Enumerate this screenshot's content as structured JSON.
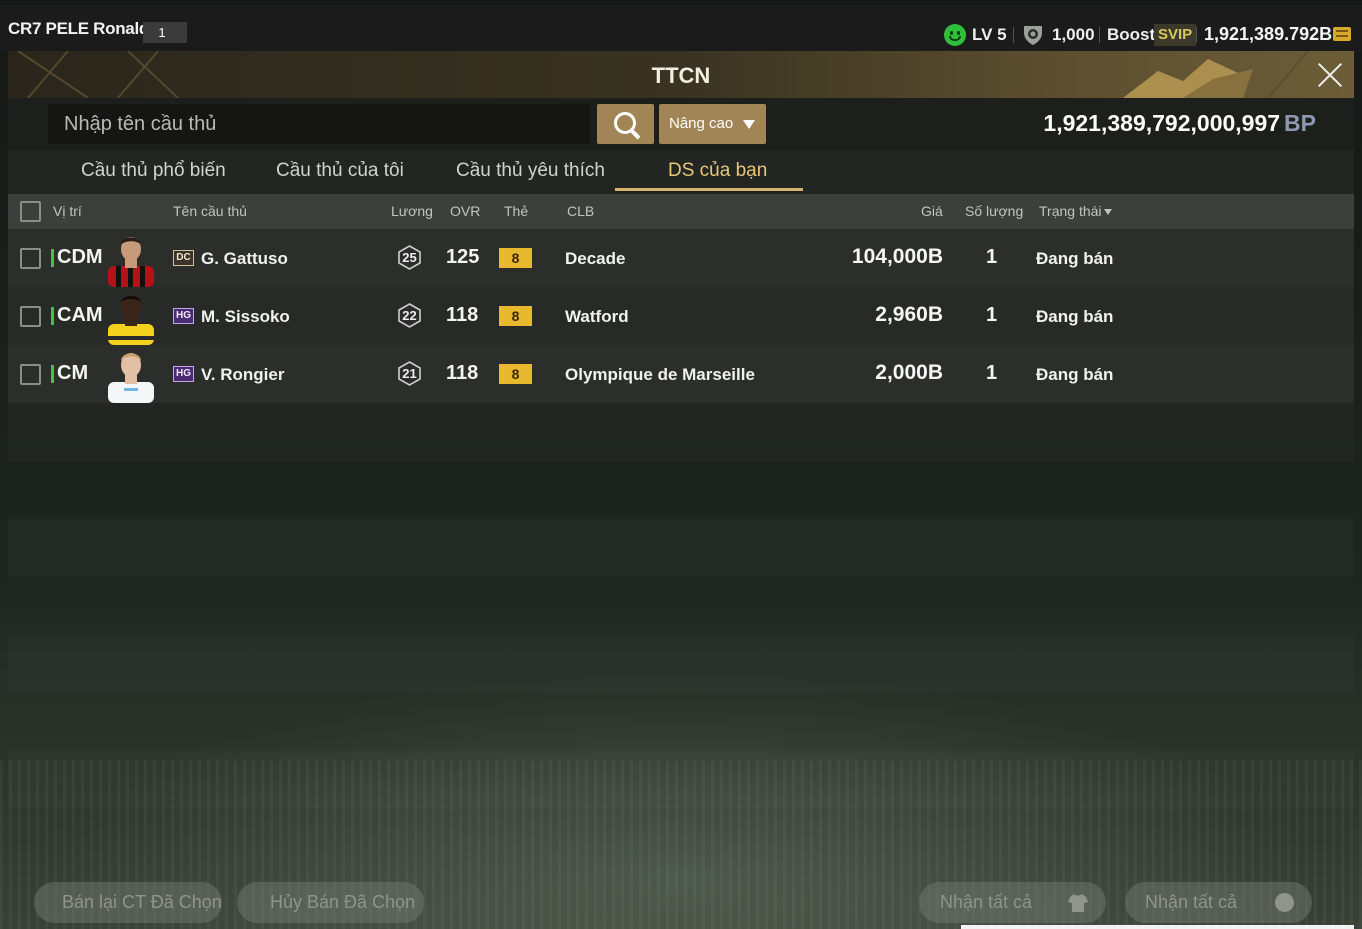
{
  "topbar": {
    "username": "CR7 PELE Ronaldo",
    "badge": "1",
    "level": "LV 5",
    "shield_value": "1,000",
    "boost_label": "Boost",
    "svip_label": "SVIP",
    "money": "1,921,389.792B"
  },
  "modal": {
    "title": "TTCN",
    "search_placeholder": "Nhập tên cầu thủ",
    "advanced_label": "Nâng cao",
    "bp_amount": "1,921,389,792,000,997",
    "bp_unit": "BP"
  },
  "tabs": [
    {
      "label": "Cầu thủ phổ biến",
      "active": false
    },
    {
      "label": "Cầu thủ của tôi",
      "active": false
    },
    {
      "label": "Cầu thủ yêu thích",
      "active": false
    },
    {
      "label": "DS của bạn",
      "active": true
    }
  ],
  "table": {
    "headers": {
      "position": "Vị trí",
      "name": "Tên cầu thủ",
      "salary": "Lương",
      "ovr": "OVR",
      "card": "Thẻ",
      "club": "CLB",
      "price": "Giá",
      "quantity": "Số lượng",
      "status": "Trạng thái"
    },
    "rows": [
      {
        "position": "CDM",
        "season": "DC",
        "name": "G. Gattuso",
        "salary": "25",
        "ovr": "125",
        "card": "8",
        "club": "Decade",
        "price": "104,000B",
        "quantity": "1",
        "status": "Đang bán"
      },
      {
        "position": "CAM",
        "season": "HG",
        "name": "M. Sissoko",
        "salary": "22",
        "ovr": "118",
        "card": "8",
        "club": "Watford",
        "price": "2,960B",
        "quantity": "1",
        "status": "Đang bán"
      },
      {
        "position": "CM",
        "season": "HG",
        "name": "V. Rongier",
        "salary": "21",
        "ovr": "118",
        "card": "8",
        "club": "Olympique de Marseille",
        "price": "2,000B",
        "quantity": "1",
        "status": "Đang bán"
      }
    ]
  },
  "actions": {
    "resell_selected": "Bán lại CT Đã Chọn",
    "cancel_selected": "Hủy Bán Đã Chọn",
    "claim_all_players": "Nhận tất cả",
    "claim_all_bp": "Nhận tất cả"
  },
  "colors": {
    "accent_gold": "#d6b56a",
    "button_brown": "#a28556",
    "position_green": "#3cc73c",
    "card_yellow": "#e8b92e"
  },
  "icons": {
    "level": "smiley-icon",
    "shield": "shield-icon",
    "currency": "coin-stack-icon",
    "close": "close-icon",
    "search": "search-icon",
    "dropdown": "chevron-down-icon",
    "claim_players": "shirt-icon",
    "claim_bp": "coin-icon"
  }
}
